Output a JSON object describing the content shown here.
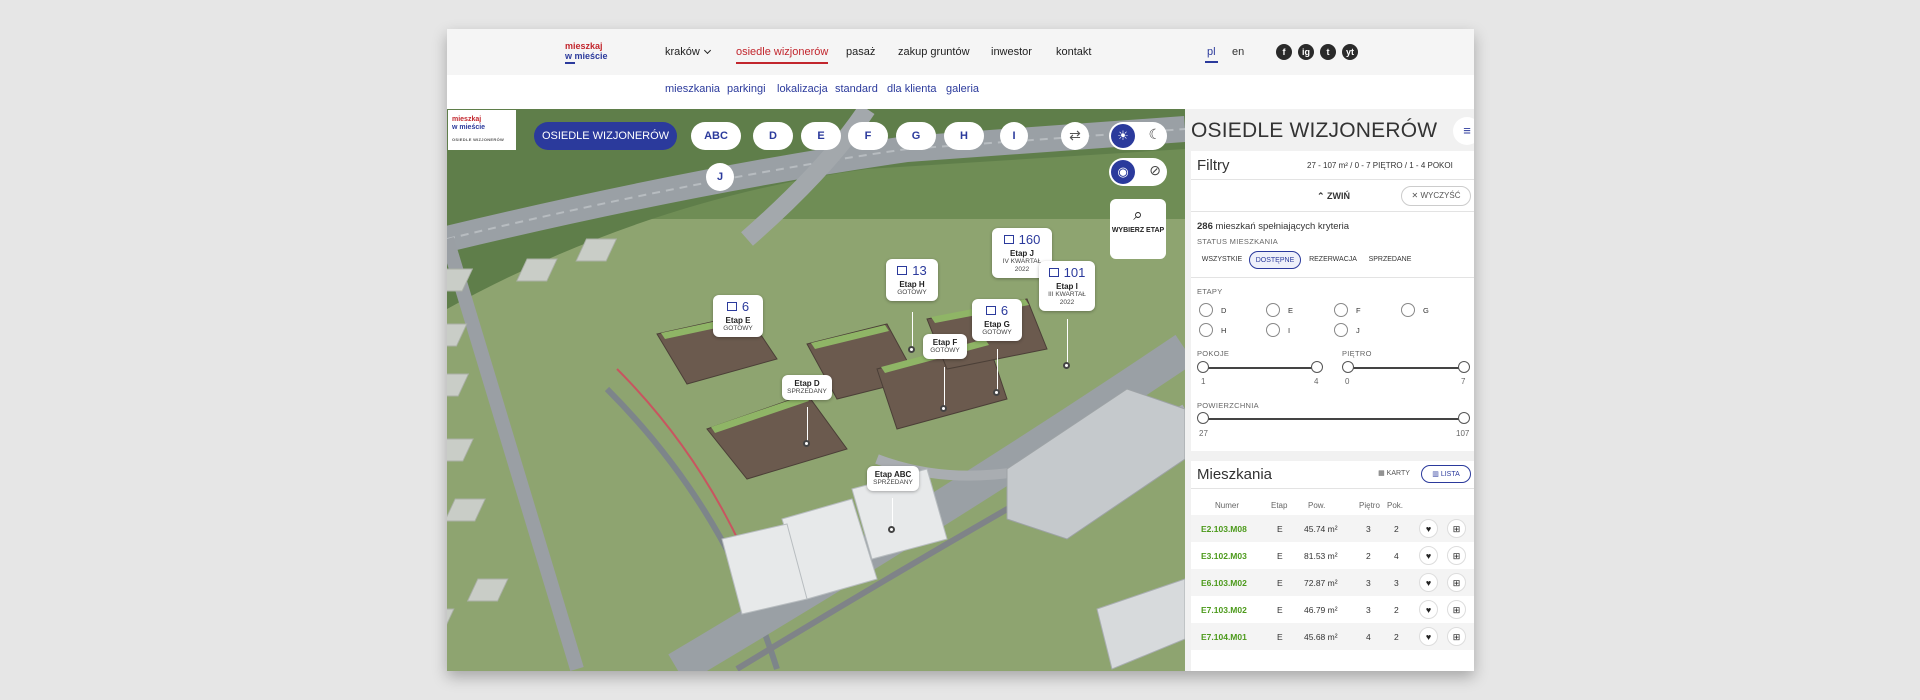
{
  "header": {
    "logo_line1": "mieszkaj",
    "logo_line2": "w mieście",
    "nav": [
      {
        "label": "kraków"
      },
      {
        "label": "osiedle wizjonerów"
      },
      {
        "label": "pasaż"
      },
      {
        "label": "zakup gruntów"
      },
      {
        "label": "inwestor"
      },
      {
        "label": "kontakt"
      }
    ],
    "lang": [
      "pl",
      "en"
    ],
    "social": [
      "f",
      "ig",
      "t",
      "yt"
    ],
    "subnav": [
      "mieszkania",
      "parkingi",
      "lokalizacja",
      "standard",
      "dla klienta",
      "galeria"
    ]
  },
  "map": {
    "logo_line1": "mieszkaj",
    "logo_line2": "w mieście",
    "logo_sub": "OSIEDLE WIZJONERÓW",
    "stage_main": "OSIEDLE WIZJONERÓW",
    "stages": [
      "ABC",
      "D",
      "E",
      "F",
      "G",
      "H",
      "I",
      "J"
    ],
    "select_stage": "WYBIERZ ETAP",
    "pins": [
      {
        "count": "6",
        "name": "Etap E",
        "status": "GOTOWY"
      },
      {
        "count": "13",
        "name": "Etap H",
        "status": "GOTOWY"
      },
      {
        "count": "160",
        "name": "Etap J",
        "status": "IV KWARTAŁ 2022"
      },
      {
        "count": "101",
        "name": "Etap I",
        "status": "III KWARTAŁ 2022"
      },
      {
        "count": "6",
        "name": "Etap G",
        "status": "GOTOWY"
      },
      {
        "count": "",
        "name": "Etap F",
        "status": "GOTOWY"
      },
      {
        "count": "",
        "name": "Etap D",
        "status": "SPRZEDANY"
      },
      {
        "count": "",
        "name": "Etap ABC",
        "status": "SPRZEDANY"
      }
    ]
  },
  "panel": {
    "title": "OSIEDLE WIZJONERÓW",
    "filters": {
      "heading": "Filtry",
      "summary": "27 - 107 m² / 0 - 7 PIĘTRO / 1 - 4 POKOI",
      "collapse": "ZWIŃ",
      "clear": "WYCZYŚĆ",
      "result_count": "286",
      "result_text": "mieszkań spełniających kryteria",
      "status_label": "STATUS MIESZKANIA",
      "status_options": [
        "WSZYSTKIE",
        "DOSTĘPNE",
        "REZERWACJA",
        "SPRZEDANE"
      ],
      "stages_label": "ETAPY",
      "stage_options": [
        "D",
        "E",
        "F",
        "G",
        "H",
        "I",
        "J"
      ],
      "rooms_label": "POKOJE",
      "rooms_min": "1",
      "rooms_max": "4",
      "floor_label": "PIĘTRO",
      "floor_min": "0",
      "floor_max": "7",
      "area_label": "POWIERZCHNIA",
      "area_min": "27",
      "area_max": "107"
    },
    "apartments": {
      "heading": "Mieszkania",
      "view_cards": "KARTY",
      "view_list": "LISTA",
      "columns": [
        "Numer",
        "Etap",
        "Pow.",
        "Piętro",
        "Pok."
      ],
      "rows": [
        {
          "code": "E2.103.M08",
          "stage": "E",
          "area": "45.74 m²",
          "floor": "3",
          "rooms": "2"
        },
        {
          "code": "E3.102.M03",
          "stage": "E",
          "area": "81.53 m²",
          "floor": "2",
          "rooms": "4"
        },
        {
          "code": "E6.103.M02",
          "stage": "E",
          "area": "72.87 m²",
          "floor": "3",
          "rooms": "3"
        },
        {
          "code": "E7.103.M02",
          "stage": "E",
          "area": "46.79 m²",
          "floor": "3",
          "rooms": "2"
        },
        {
          "code": "E7.104.M01",
          "stage": "E",
          "area": "45.68 m²",
          "floor": "4",
          "rooms": "2"
        }
      ]
    }
  }
}
